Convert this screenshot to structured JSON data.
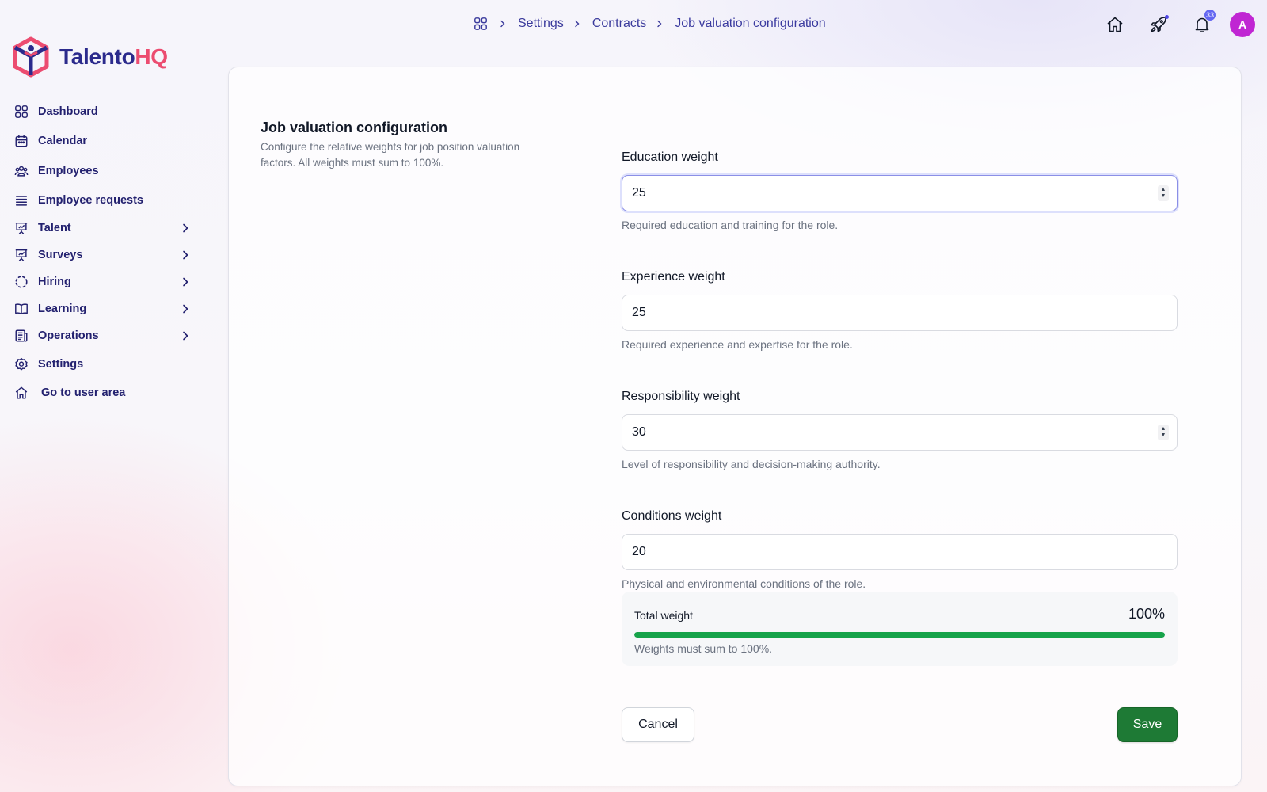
{
  "brand": {
    "name_part1": "Talento",
    "name_part2": "HQ",
    "primary": "#2b2a8c",
    "accent": "#ec4c70"
  },
  "sidebar": {
    "items": [
      {
        "label": "Dashboard",
        "icon": "grid-icon",
        "expandable": false
      },
      {
        "label": "Calendar",
        "icon": "calendar-icon",
        "expandable": false
      },
      {
        "label": "Employees",
        "icon": "users-icon",
        "expandable": false
      },
      {
        "label": "Employee requests",
        "icon": "list-icon",
        "expandable": false
      },
      {
        "label": "Talent",
        "icon": "presentation-chart-icon",
        "expandable": true
      },
      {
        "label": "Surveys",
        "icon": "presentation-chart-icon",
        "expandable": true
      },
      {
        "label": "Hiring",
        "icon": "dashed-circle-icon",
        "expandable": true
      },
      {
        "label": "Learning",
        "icon": "book-icon",
        "expandable": true
      },
      {
        "label": "Operations",
        "icon": "document-icon",
        "expandable": true
      },
      {
        "label": "Settings",
        "icon": "gear-icon",
        "expandable": false
      },
      {
        "label": "Go to user area",
        "icon": "home-icon",
        "expandable": false
      }
    ]
  },
  "breadcrumb": {
    "home_icon": "grid-icon",
    "items": [
      "Settings",
      "Contracts",
      "Job valuation configuration"
    ]
  },
  "topbar": {
    "notifications_count": "33",
    "avatar_initial": "A",
    "avatar_color": "#c026d3"
  },
  "section": {
    "title": "Job valuation configuration",
    "description": "Configure the relative weights for job position valuation factors. All weights must sum to 100%."
  },
  "fields": [
    {
      "label": "Education weight",
      "value": "25",
      "help": "Required education and training for the role."
    },
    {
      "label": "Experience weight",
      "value": "25",
      "help": "Required experience and expertise for the role."
    },
    {
      "label": "Responsibility weight",
      "value": "30",
      "help": "Level of responsibility and decision-making authority."
    },
    {
      "label": "Conditions weight",
      "value": "20",
      "help": "Physical and environmental conditions of the role."
    }
  ],
  "total": {
    "label": "Total weight",
    "value": "100%",
    "progress_percent": 100,
    "help": "Weights must sum to 100%.",
    "bar_color": "#16a34a"
  },
  "actions": {
    "cancel_label": "Cancel",
    "save_label": "Save",
    "save_color": "#1e7a35"
  }
}
